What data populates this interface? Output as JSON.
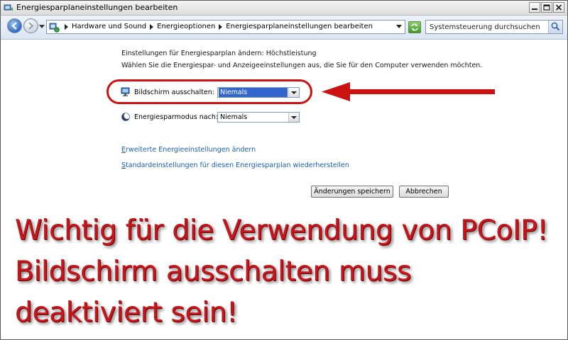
{
  "window": {
    "title": "Energiesparplaneinstellungen bearbeiten"
  },
  "address": {
    "breadcrumbs": [
      "Hardware und Sound",
      "Energieoptionen",
      "Energiesparplaneinstellungen bearbeiten"
    ],
    "search_placeholder": "Systemsteuerung durchsuchen"
  },
  "content": {
    "heading": "Einstellungen für Energiesparplan ändern: Höchstleistung",
    "subheading": "Wählen Sie die Energiespar- und Anzeigeeinstellungen aus, die Sie für den Computer verwenden möchten.",
    "display_off": {
      "label": "Bildschirm ausschalten:",
      "value": "Niemals"
    },
    "sleep": {
      "label": "Energiesparmodus nach:",
      "value": "Niemals"
    },
    "link_advanced": {
      "first_letter": "E",
      "rest": "rweiterte Energieeinstellungen ändern"
    },
    "link_restore": {
      "first_letter": "S",
      "rest": "tandardeinstellungen für diesen Energiesparplan wiederherstellen"
    },
    "save_label": "Änderungen speichern",
    "cancel_label": "Abbrechen"
  },
  "overlay": {
    "line1": "Wichtig für die Verwendung von PCoIP!",
    "line2": "Bildschirm ausschalten muss",
    "line3": "deaktiviert sein!"
  },
  "colors": {
    "annotation_red": "#cc1111",
    "overlay_text": "#c4161c",
    "link_blue": "#1a5fb4",
    "selection_blue": "#3366cc"
  },
  "icons": {
    "window": "power-options-icon",
    "back": "back-arrow-icon",
    "forward": "forward-arrow-icon",
    "refresh": "refresh-icon",
    "search": "search-icon",
    "display": "monitor-icon",
    "sleep": "moon-icon"
  }
}
